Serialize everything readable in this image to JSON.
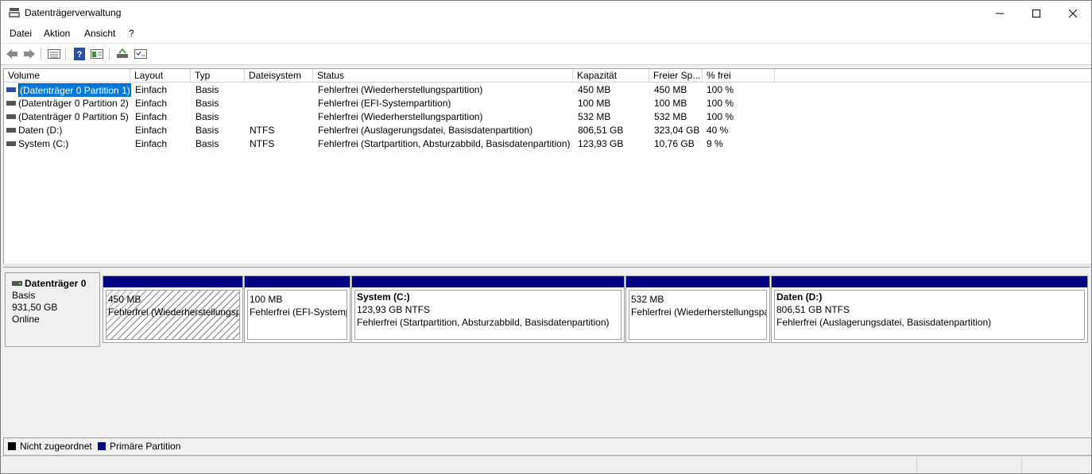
{
  "window": {
    "title": "Datenträgerverwaltung"
  },
  "menu": [
    "Datei",
    "Aktion",
    "Ansicht",
    "?"
  ],
  "toolbar": {
    "icons": [
      "back-icon",
      "forward-icon",
      "list-view-icon",
      "help-icon",
      "properties-icon",
      "rescan-icon",
      "settings-icon"
    ]
  },
  "columns": [
    "Volume",
    "Layout",
    "Typ",
    "Dateisystem",
    "Status",
    "Kapazität",
    "Freier Sp...",
    "% frei"
  ],
  "volumes": [
    {
      "volume": "(Datenträger 0 Partition 1)",
      "layout": "Einfach",
      "typ": "Basis",
      "fs": "",
      "status": "Fehlerfrei (Wiederherstellungspartition)",
      "cap": "450 MB",
      "free": "450 MB",
      "pct": "100 %"
    },
    {
      "volume": "(Datenträger 0 Partition 2)",
      "layout": "Einfach",
      "typ": "Basis",
      "fs": "",
      "status": "Fehlerfrei (EFI-Systempartition)",
      "cap": "100 MB",
      "free": "100 MB",
      "pct": "100 %"
    },
    {
      "volume": "(Datenträger 0 Partition 5)",
      "layout": "Einfach",
      "typ": "Basis",
      "fs": "",
      "status": "Fehlerfrei (Wiederherstellungspartition)",
      "cap": "532 MB",
      "free": "532 MB",
      "pct": "100 %"
    },
    {
      "volume": "Daten (D:)",
      "layout": "Einfach",
      "typ": "Basis",
      "fs": "NTFS",
      "status": "Fehlerfrei (Auslagerungsdatei, Basisdatenpartition)",
      "cap": "806,51 GB",
      "free": "323,04 GB",
      "pct": "40 %"
    },
    {
      "volume": "System (C:)",
      "layout": "Einfach",
      "typ": "Basis",
      "fs": "NTFS",
      "status": "Fehlerfrei (Startpartition, Absturzabbild, Basisdatenpartition)",
      "cap": "123,93 GB",
      "free": "10,76 GB",
      "pct": "9 %"
    }
  ],
  "disk": {
    "name": "Datenträger 0",
    "type": "Basis",
    "size": "931,50 GB",
    "state": "Online"
  },
  "partitions": [
    {
      "name": "",
      "size": "450 MB",
      "status": "Fehlerfrei (Wiederherstellungsp"
    },
    {
      "name": "",
      "size": "100 MB",
      "status": "Fehlerfrei (EFI-Systemp"
    },
    {
      "name": "System  (C:)",
      "size": "123,93 GB NTFS",
      "status": "Fehlerfrei (Startpartition, Absturzabbild, Basisdatenpartition)"
    },
    {
      "name": "",
      "size": "532 MB",
      "status": "Fehlerfrei (Wiederherstellungspa"
    },
    {
      "name": "Daten  (D:)",
      "size": "806,51 GB NTFS",
      "status": "Fehlerfrei (Auslagerungsdatei, Basisdatenpartition)"
    }
  ],
  "legend": {
    "unallocated": "Nicht zugeordnet",
    "primary": "Primäre Partition"
  },
  "colors": {
    "primary_partition": "#000080",
    "unallocated": "#000000",
    "selection": "#0078d7"
  }
}
